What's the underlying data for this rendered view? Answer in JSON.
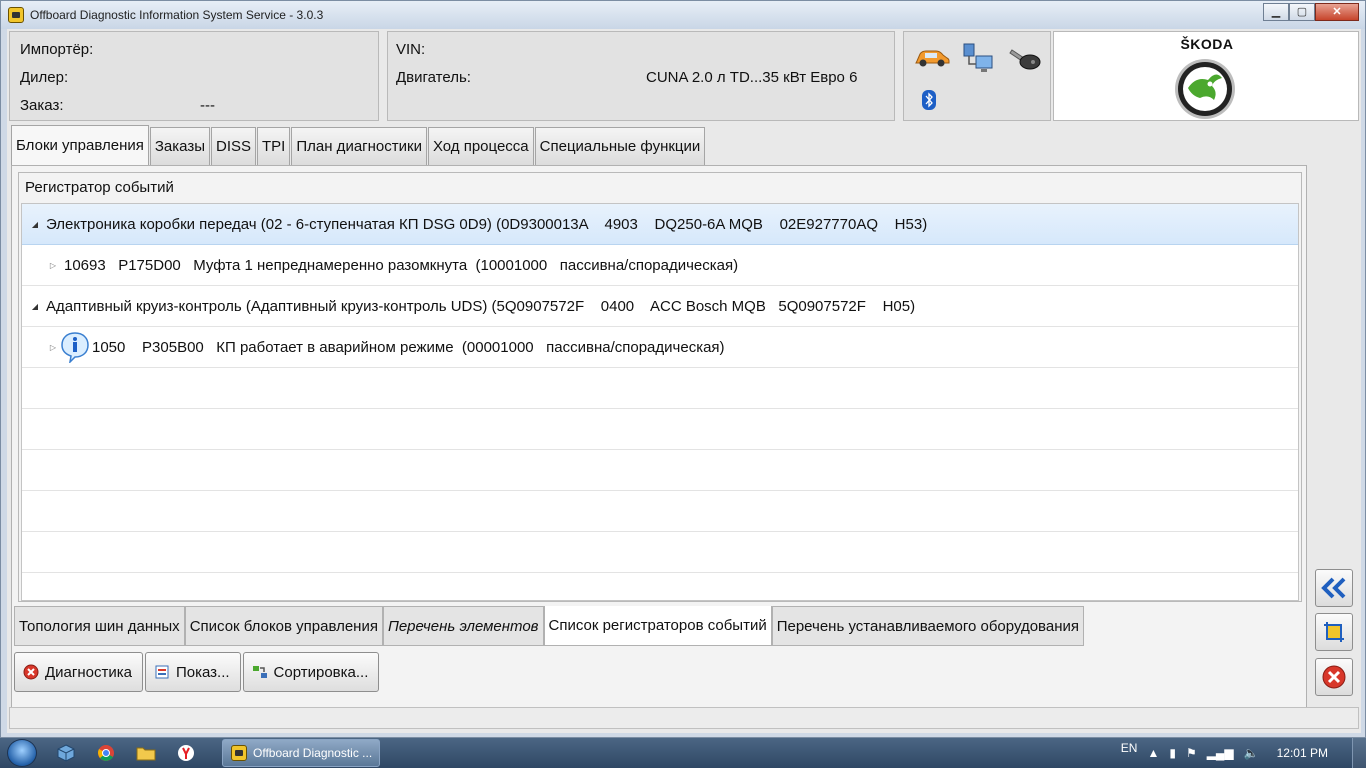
{
  "window": {
    "title": "Offboard Diagnostic Information System Service - 3.0.3"
  },
  "header": {
    "importer_label": "Импортёр:",
    "dealer_label": "Дилер:",
    "order_label": "Заказ:",
    "order_value": "---",
    "vin_label": "VIN:",
    "engine_label": "Двигатель:",
    "engine_value": "CUNA 2.0 л TD...35 кВт Евро 6",
    "brand": "ŠKODA"
  },
  "tabs": [
    {
      "label": "Блоки управления",
      "active": true
    },
    {
      "label": "Заказы"
    },
    {
      "label": "DISS"
    },
    {
      "label": "TPI"
    },
    {
      "label": "План диагностики"
    },
    {
      "label": "Ход процесса"
    },
    {
      "label": "Специальные функции"
    }
  ],
  "event_log": {
    "title": "Регистратор событий",
    "rows": [
      {
        "text": "Электроника коробки передач (02 - 6-ступенчатая КП DSG 0D9) (0D9300013A    4903    DQ250-6A MQB    02E927770AQ    H53)"
      },
      {
        "text": "10693   P175D00   Муфта 1 непреднамеренно разомкнута  (10001000   пассивна/спорадическая)"
      },
      {
        "text": "Адаптивный круиз-контроль (Адаптивный круиз-контроль UDS) (5Q0907572F    0400    ACC Bosch MQB   5Q0907572F    H05)"
      },
      {
        "text": "1050    P305B00   КП работает в аварийном режиме  (00001000   пассивна/спорадическая)"
      }
    ]
  },
  "subtabs": [
    {
      "label": "Топология шин данных"
    },
    {
      "label": "Список блоков управления"
    },
    {
      "label": "Перечень элементов"
    },
    {
      "label": "Список регистраторов событий",
      "active": true
    },
    {
      "label": "Перечень устанавливаемого оборудования"
    }
  ],
  "buttons": {
    "diagnostics": "Диагностика",
    "show": "Показ...",
    "sort": "Сортировка..."
  },
  "taskbar": {
    "task_label": "Offboard Diagnostic ...",
    "lang": "EN",
    "clock": "12:01 PM"
  },
  "colors": {
    "selected_row": "#d6e8fb",
    "skoda_green": "#4ba82e",
    "nav_blue": "#1f5fbf",
    "close_red": "#d8372a"
  }
}
